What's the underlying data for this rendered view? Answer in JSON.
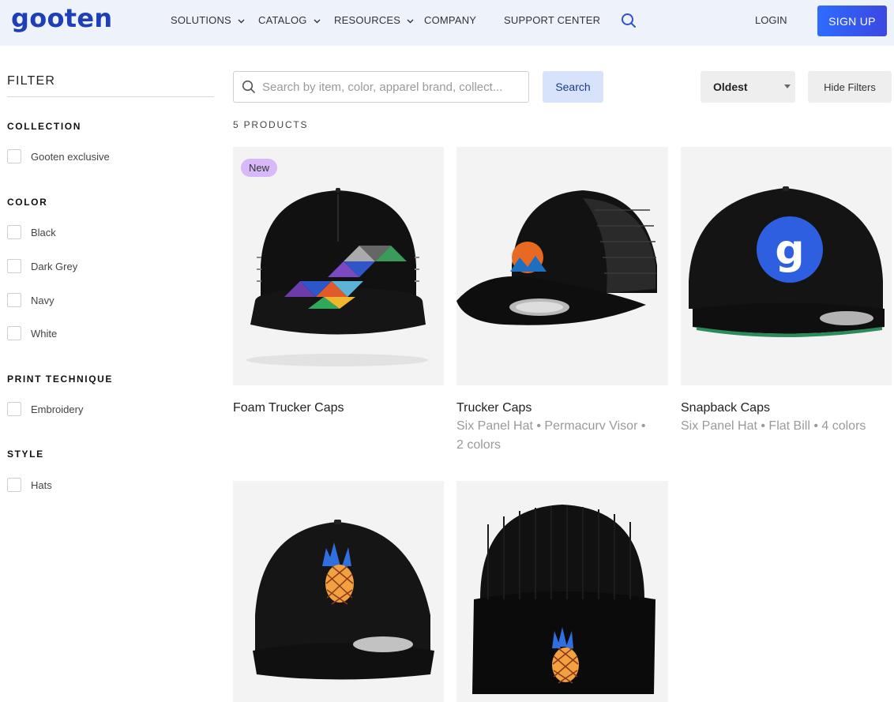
{
  "header": {
    "logo": "gooten",
    "nav": [
      {
        "label": "SOLUTIONS",
        "has_dropdown": true
      },
      {
        "label": "CATALOG",
        "has_dropdown": true
      },
      {
        "label": "RESOURCES",
        "has_dropdown": true
      },
      {
        "label": "COMPANY",
        "has_dropdown": false
      },
      {
        "label": "SUPPORT CENTER",
        "has_dropdown": false
      }
    ],
    "search_icon": "search-icon",
    "login": "LOGIN",
    "signup": "SIGN UP"
  },
  "filter": {
    "title": "FILTER",
    "groups": [
      {
        "title": "COLLECTION",
        "options": [
          "Gooten exclusive"
        ]
      },
      {
        "title": "COLOR",
        "options": [
          "Black",
          "Dark Grey",
          "Navy",
          "White"
        ]
      },
      {
        "title": "PRINT TECHNIQUE",
        "options": [
          "Embroidery"
        ]
      },
      {
        "title": "STYLE",
        "options": [
          "Hats"
        ]
      }
    ]
  },
  "toolbar": {
    "search_placeholder": "Search by item, color, apparel brand, collect...",
    "search_button": "Search",
    "sort_value": "Oldest",
    "hide_filters": "Hide Filters",
    "product_count": "5 PRODUCTS"
  },
  "products": [
    {
      "title": "Foam Trucker Caps",
      "subtitle": "",
      "badge": "New"
    },
    {
      "title": "Trucker Caps",
      "subtitle_line1": "Six Panel Hat • Permacurv Visor •",
      "subtitle_line2": "2 colors"
    },
    {
      "title": "Snapback Caps",
      "subtitle_line1": "Six Panel Hat • Flat Bill • 4 colors",
      "subtitle_line2": ""
    },
    {
      "title": "",
      "subtitle": ""
    },
    {
      "title": "",
      "subtitle": ""
    }
  ],
  "colors": {
    "brand": "#1e3fb8",
    "signup_gradient_start": "#2f6bff",
    "signup_gradient_end": "#3b48e0",
    "badge_new": "#d7b8f8",
    "search_button_bg": "#d6e3fb"
  }
}
